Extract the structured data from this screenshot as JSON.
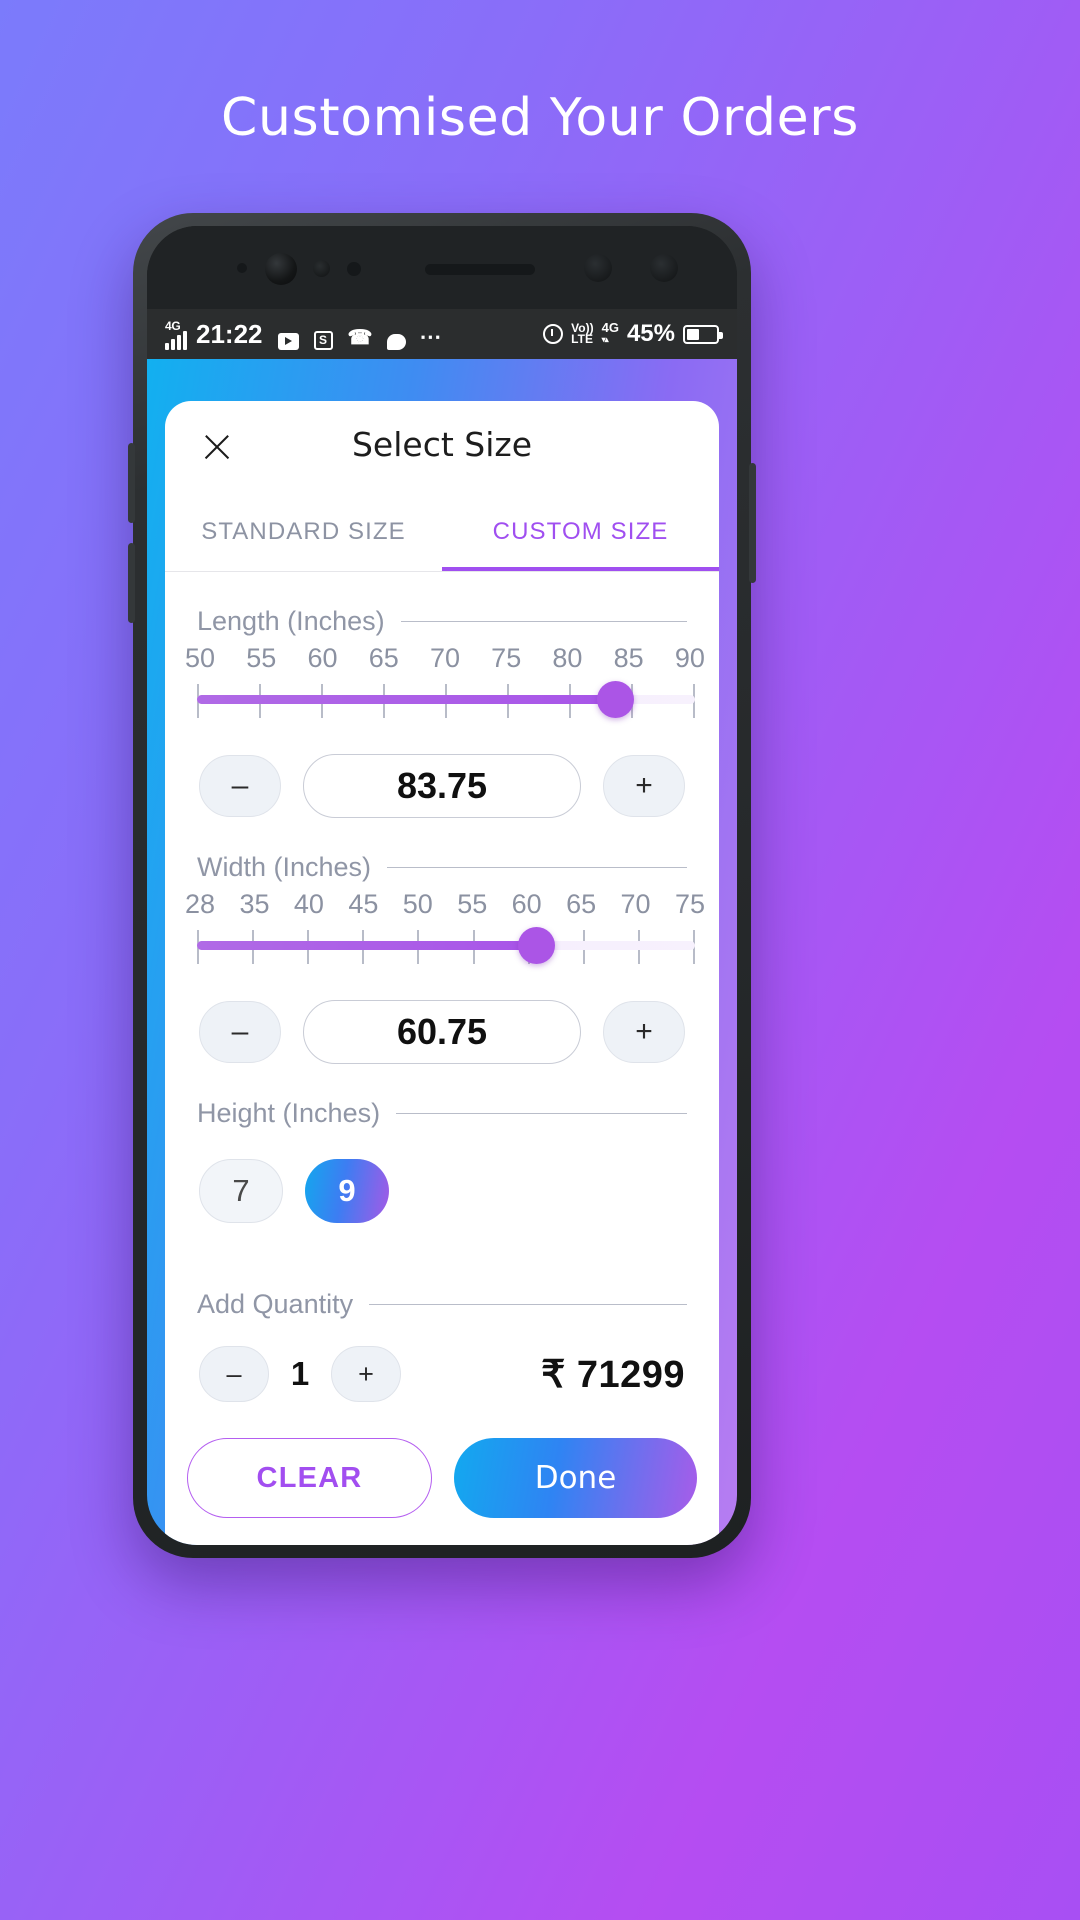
{
  "headline": "Customised Your Orders",
  "status_bar": {
    "network_badge": "4G",
    "time": "21:22",
    "icons": [
      "play-icon",
      "screenshot-icon",
      "call-icon",
      "chat-icon",
      "more-icon"
    ],
    "alarm_icon": "alarm-icon",
    "volte_top": "Vo))",
    "volte_bottom": "LTE",
    "data_network": "4G",
    "battery_percent": "45%"
  },
  "sheet": {
    "close_icon": "close-icon",
    "title": "Select Size",
    "tabs": [
      {
        "label": "STANDARD SIZE",
        "active": false
      },
      {
        "label": "CUSTOM SIZE",
        "active": true
      }
    ],
    "length": {
      "label": "Length (Inches)",
      "ticks": [
        "50",
        "55",
        "60",
        "65",
        "70",
        "75",
        "80",
        "85",
        "90"
      ],
      "value": "83.75",
      "minus_label": "–",
      "plus_label": "+",
      "fill_percent": 84,
      "thumb_percent": 84
    },
    "width": {
      "label": "Width (Inches)",
      "ticks": [
        "28",
        "35",
        "40",
        "45",
        "50",
        "55",
        "60",
        "65",
        "70",
        "75"
      ],
      "value": "60.75",
      "minus_label": "–",
      "plus_label": "+",
      "fill_percent": 68,
      "thumb_percent": 68
    },
    "height": {
      "label": "Height (Inches)",
      "options": [
        {
          "label": "7",
          "selected": false
        },
        {
          "label": "9",
          "selected": true
        }
      ]
    },
    "quantity": {
      "label": "Add Quantity",
      "minus_label": "–",
      "plus_label": "+",
      "value": "1"
    },
    "price": "₹ 71299",
    "actions": {
      "clear_label": "CLEAR",
      "done_label": "Done"
    }
  },
  "colors": {
    "accent_purple": "#a04ff0",
    "slider_purple": "#ab55e6",
    "gradient_start": "#12a9ef",
    "gradient_end": "#a85ce9",
    "muted_text": "#8b91a1"
  }
}
